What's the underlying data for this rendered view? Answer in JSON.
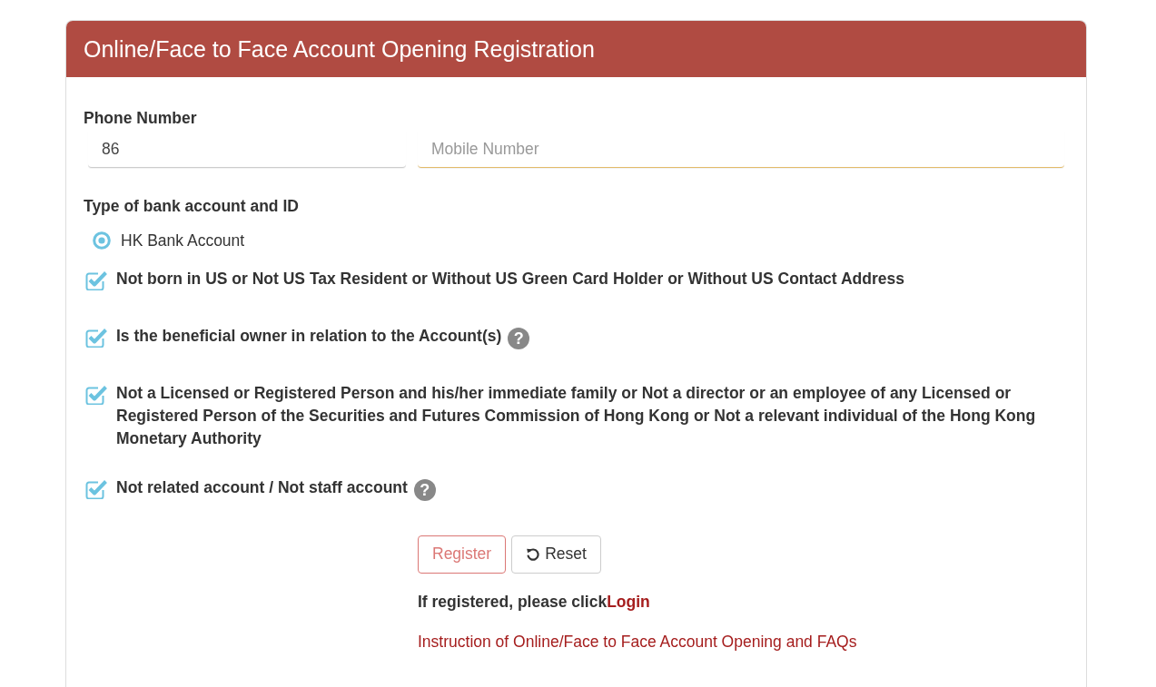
{
  "header": {
    "title": "Online/Face to Face Account Opening Registration"
  },
  "phone": {
    "label": "Phone Number",
    "country_code": {
      "value": "86",
      "focused": false
    },
    "mobile": {
      "placeholder": "Mobile Number",
      "focused": true
    }
  },
  "account_type": {
    "label": "Type of bank account and ID",
    "options": [
      {
        "label": "HK Bank Account",
        "selected": true
      }
    ]
  },
  "declarations": [
    {
      "text": "Not born in US or Not US Tax Resident or Without US Green Card Holder or Without US Contact Address",
      "checked": true
    },
    {
      "text": "Is the beneficial owner in relation to the Account(s)",
      "checked": true,
      "help": "?"
    },
    {
      "text": "Not a Licensed or Registered Person and his/her immediate family or Not a director or an employee of any Licensed or Registered Person of the Securities and Futures Commission of Hong Kong or Not a relevant individual of the Hong Kong Monetary Authority",
      "checked": true
    },
    {
      "text": "Not related account / Not staff account",
      "checked": true,
      "help": "?"
    }
  ],
  "buttons": [
    {
      "kind": "register",
      "label": "Register",
      "disabled": true
    },
    {
      "kind": "reset",
      "label": "Reset",
      "disabled": false
    }
  ],
  "login_prompt": {
    "text": "If registered, please click",
    "link": "Login"
  },
  "instruction_link": "Instruction of Online/Face to Face Account Opening and FAQs"
}
